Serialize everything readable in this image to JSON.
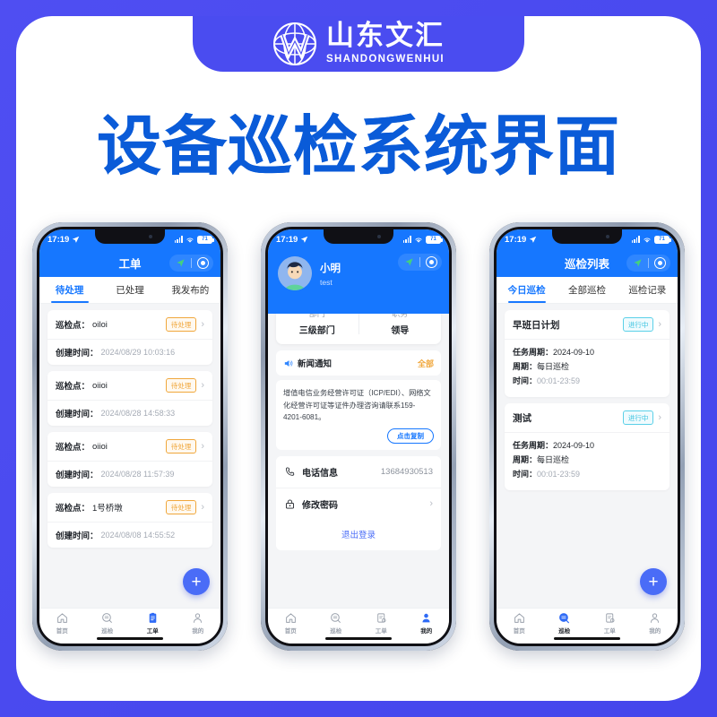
{
  "poster": {
    "brand_cn": "山东文汇",
    "brand_en": "SHANDONGWENHUI",
    "logo_icon": "globe-w-logo-icon",
    "headline": "设备巡检系统界面",
    "bg_color": "#4a4cf0",
    "headline_color": "#0a56d6"
  },
  "statusbar": {
    "time": "17:19",
    "battery": "71",
    "location_icon": "location-arrow-icon",
    "wifi_icon": "wifi-icon",
    "signal_icon": "signal-bars-icon"
  },
  "header_controls": {
    "nav_icon": "navigation-arrow-icon",
    "target_icon": "target-ring-icon"
  },
  "phone1": {
    "appbar_title": "工单",
    "tabs": [
      {
        "label": "待处理",
        "active": true
      },
      {
        "label": "已处理",
        "active": false
      },
      {
        "label": "我发布的",
        "active": false
      }
    ],
    "card_labels": {
      "point": "巡检点：",
      "created": "创建时间："
    },
    "cards": [
      {
        "point": "oiloi",
        "status": "待处理",
        "created": "2024/08/29 10:03:16"
      },
      {
        "point": "oiioi",
        "status": "待处理",
        "created": "2024/08/28 14:58:33"
      },
      {
        "point": "oiioi",
        "status": "待处理",
        "created": "2024/08/28 11:57:39"
      },
      {
        "point": "1号桥墩",
        "status": "待处理",
        "created": "2024/08/08 14:55:52"
      }
    ],
    "fab": "+",
    "nav": [
      {
        "label": "首页",
        "icon": "home-icon",
        "active": false
      },
      {
        "label": "巡检",
        "icon": "inspection-icon",
        "active": false
      },
      {
        "label": "工单",
        "icon": "clipboard-icon",
        "active": true
      },
      {
        "label": "我的",
        "icon": "person-icon",
        "active": false
      }
    ]
  },
  "phone2": {
    "user_name": "小明",
    "user_sub": "test",
    "avatar_icon": "user-avatar-icon",
    "dept": [
      {
        "key": "部门",
        "value": "三级部门"
      },
      {
        "key": "职务",
        "value": "领导"
      }
    ],
    "news": {
      "icon": "speaker-announcement-icon",
      "title": "新闻通知",
      "all_label": "全部",
      "text": "增值电信业务经营许可证（ICP/EDI）、网络文化经营许可证等证件办理咨询请联系159-4201-6081。",
      "copy_label": "点击复制"
    },
    "rows": [
      {
        "icon": "phone-icon",
        "label": "电话信息",
        "value": "13684930513",
        "chevron": false
      },
      {
        "icon": "lock-icon",
        "label": "修改密码",
        "value": "",
        "chevron": true
      }
    ],
    "logout_label": "退出登录",
    "nav": [
      {
        "label": "首页",
        "icon": "home-icon",
        "active": false
      },
      {
        "label": "巡检",
        "icon": "inspection-icon",
        "active": false
      },
      {
        "label": "工单",
        "icon": "clipboard-icon",
        "active": false
      },
      {
        "label": "我的",
        "icon": "person-icon",
        "active": true
      }
    ]
  },
  "phone3": {
    "appbar_title": "巡检列表",
    "tabs": [
      {
        "label": "今日巡检",
        "active": true
      },
      {
        "label": "全部巡检",
        "active": false
      },
      {
        "label": "巡检记录",
        "active": false
      }
    ],
    "labels": {
      "cycle": "任务周期：",
      "period": "周期：",
      "time": "时间："
    },
    "cards": [
      {
        "title": "早班日计划",
        "status": "进行中",
        "cycle": "2024-09-10",
        "period": "每日巡检",
        "time": "00:01-23:59"
      },
      {
        "title": "测试",
        "status": "进行中",
        "cycle": "2024-09-10",
        "period": "每日巡检",
        "time": "00:01-23:59"
      }
    ],
    "fab": "+",
    "nav": [
      {
        "label": "首页",
        "icon": "home-icon",
        "active": false
      },
      {
        "label": "巡检",
        "icon": "inspection-icon",
        "active": true
      },
      {
        "label": "工单",
        "icon": "clipboard-icon",
        "active": false
      },
      {
        "label": "我的",
        "icon": "person-icon",
        "active": false
      }
    ]
  }
}
